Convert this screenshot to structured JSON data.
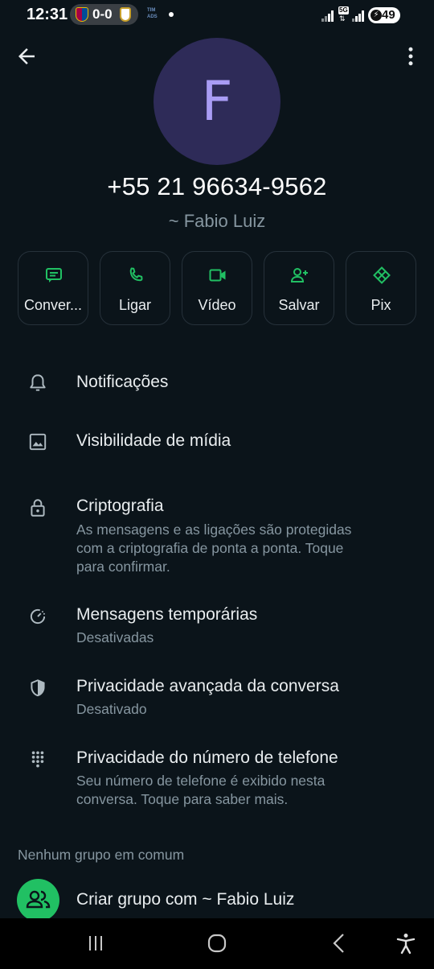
{
  "status_bar": {
    "time": "12:31",
    "score": "0-0",
    "carrier_line1": "TIM",
    "carrier_line2": "ADS",
    "network": "5G",
    "battery": "49"
  },
  "header": {
    "avatar_initial": "F",
    "phone_number": "+55 21 96634-9562",
    "push_name": "~ Fabio Luiz"
  },
  "actions": [
    {
      "label": "Conver...",
      "icon": "message-icon"
    },
    {
      "label": "Ligar",
      "icon": "phone-icon"
    },
    {
      "label": "Vídeo",
      "icon": "video-icon"
    },
    {
      "label": "Salvar",
      "icon": "add-contact-icon"
    },
    {
      "label": "Pix",
      "icon": "pix-icon"
    }
  ],
  "settings": {
    "notifications": {
      "title": "Notificações"
    },
    "media_visibility": {
      "title": "Visibilidade de mídia"
    },
    "encryption": {
      "title": "Criptografia",
      "line1": "As mensagens e as ligações são protegidas",
      "line2": "com a criptografia de ponta a ponta. Toque",
      "line3": "para confirmar."
    },
    "disappearing": {
      "title": "Mensagens temporárias",
      "subtitle": "Desativadas"
    },
    "advanced_privacy": {
      "title": "Privacidade avançada da conversa",
      "subtitle": "Desativado"
    },
    "phone_privacy": {
      "title": "Privacidade do número de telefone",
      "line1": "Seu número de telefone é exibido nesta",
      "line2": "conversa. Toque para saber mais."
    }
  },
  "groups": {
    "section_label": "Nenhum grupo em comum",
    "create_label": "Criar grupo com ~ Fabio Luiz"
  },
  "colors": {
    "background": "#0b141a",
    "accent": "#21c063",
    "avatar_bg": "#2e2b58",
    "avatar_fg": "#a99cf5"
  }
}
